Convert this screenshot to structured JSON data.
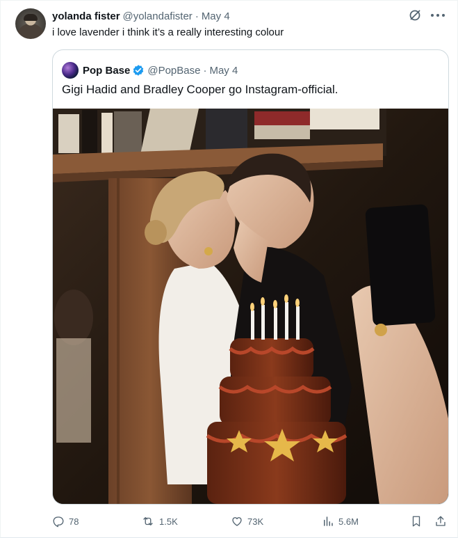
{
  "tweet": {
    "display_name": "yolanda fister",
    "handle": "@yolandafister",
    "separator": "·",
    "date": "May 4",
    "text": "i love lavender i think it’s a really interesting colour"
  },
  "quoted_tweet": {
    "display_name": "Pop Base",
    "handle": "@PopBase",
    "separator": "·",
    "date": "May 4",
    "text": "Gigi Hadid and Bradley Cooper go Instagram-official.",
    "verified": true,
    "image_alt": "Couple kissing in front of a tiered chocolate birthday cake with lit candles"
  },
  "actions": {
    "replies": "78",
    "reposts": "1.5K",
    "likes": "73K",
    "views": "5.6M"
  },
  "icons": {
    "top_right": [
      "grok-icon",
      "more-icon"
    ],
    "verified": "verified-badge-icon",
    "bar": [
      "reply-icon",
      "retweet-icon",
      "like-icon",
      "views-icon",
      "bookmark-icon",
      "share-icon"
    ]
  },
  "colors": {
    "text_primary": "#0f1419",
    "text_secondary": "#536471",
    "verified_blue": "#1d9bf0",
    "border": "#cfd9de"
  }
}
